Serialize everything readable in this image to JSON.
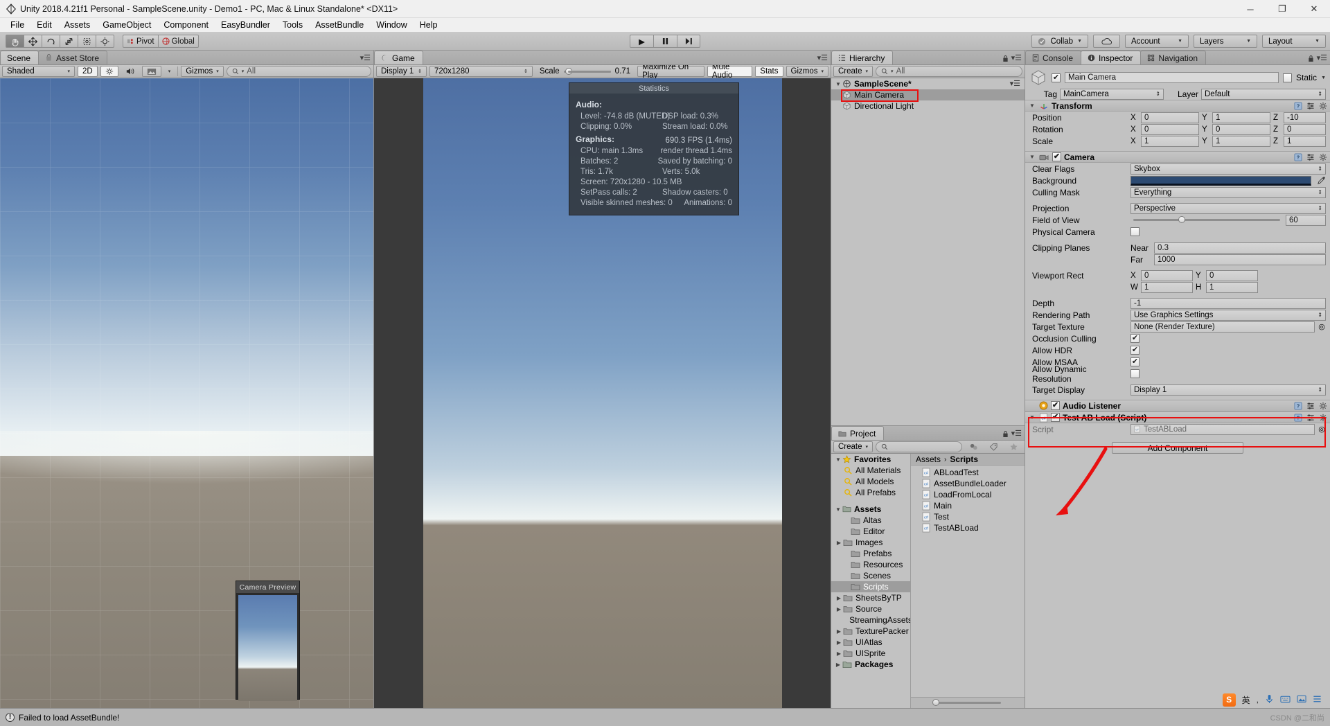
{
  "window": {
    "title": "Unity 2018.4.21f1 Personal - SampleScene.unity - Demo1 - PC, Mac & Linux Standalone* <DX11>",
    "minimize": "─",
    "maximize": "❐",
    "close": "✕"
  },
  "menu": [
    "File",
    "Edit",
    "Assets",
    "GameObject",
    "Component",
    "EasyBundler",
    "Tools",
    "AssetBundle",
    "Window",
    "Help"
  ],
  "toolbar": {
    "transform_tools": [
      "hand-tool",
      "move-tool",
      "rotate-tool",
      "scale-tool",
      "rect-tool",
      "transform-tool"
    ],
    "pivot_label": "Pivot",
    "global_label": "Global",
    "play": "▶",
    "pause": "▐▐",
    "step": "▶|",
    "collab_label": "Collab",
    "cloud_label": "cloud-icon",
    "account_label": "Account",
    "layers_label": "Layers",
    "layout_label": "Layout"
  },
  "scene_panel": {
    "tabs": [
      {
        "label": "Scene",
        "active": true
      },
      {
        "label": "Asset Store",
        "active": false
      }
    ],
    "shading_mode": "Shaded",
    "mode_2d": "2D",
    "gizmos_label": "Gizmos",
    "search_placeholder": "All",
    "camera_preview_title": "Camera Preview"
  },
  "game_panel": {
    "tabs": [
      {
        "label": "Game",
        "active": true
      }
    ],
    "display": "Display 1",
    "resolution": "720x1280",
    "scale_label": "Scale",
    "scale_value": "0.71",
    "maximize_on_play": "Maximize On Play",
    "mute_audio": "Mute Audio",
    "stats": "Stats",
    "gizmos": "Gizmos"
  },
  "statistics": {
    "title": "Statistics",
    "audio_header": "Audio:",
    "audio_rows": [
      {
        "left": "Level: -74.8 dB (MUTED)",
        "right": "DSP load: 0.3%"
      },
      {
        "left": "Clipping: 0.0%",
        "right": "Stream load: 0.0%"
      }
    ],
    "graphics_header": "Graphics:",
    "fps": "690.3 FPS (1.4ms)",
    "graphics_rows": [
      {
        "left": "CPU: main 1.3ms",
        "right": "render thread 1.4ms"
      },
      {
        "left": "Batches: 2",
        "right": "Saved by batching: 0"
      },
      {
        "left": "Tris: 1.7k",
        "right": "Verts: 5.0k"
      },
      {
        "left": "Screen: 720x1280 - 10.5 MB",
        "right": ""
      },
      {
        "left": "SetPass calls: 2",
        "right": "Shadow casters: 0"
      },
      {
        "left": "Visible skinned meshes: 0",
        "right": "Animations: 0"
      }
    ]
  },
  "hierarchy": {
    "tab_label": "Hierarchy",
    "create_label": "Create",
    "search_placeholder": "All",
    "scene_name": "SampleScene*",
    "items": [
      {
        "label": "Main Camera",
        "selected": true,
        "highlighted": true
      },
      {
        "label": "Directional Light",
        "selected": false,
        "highlighted": false
      }
    ]
  },
  "project": {
    "tab_label": "Project",
    "create_label": "Create",
    "search_placeholder": "",
    "favorites_label": "Favorites",
    "favorites": [
      "All Materials",
      "All Models",
      "All Prefabs"
    ],
    "assets_label": "Assets",
    "folders": [
      {
        "label": "Altas",
        "expandable": false,
        "selected": false
      },
      {
        "label": "Editor",
        "expandable": false,
        "selected": false
      },
      {
        "label": "Images",
        "expandable": true,
        "selected": false
      },
      {
        "label": "Prefabs",
        "expandable": false,
        "selected": false
      },
      {
        "label": "Resources",
        "expandable": false,
        "selected": false
      },
      {
        "label": "Scenes",
        "expandable": false,
        "selected": false
      },
      {
        "label": "Scripts",
        "expandable": false,
        "selected": true
      },
      {
        "label": "SheetsByTP",
        "expandable": true,
        "selected": false
      },
      {
        "label": "Source",
        "expandable": true,
        "selected": false
      },
      {
        "label": "StreamingAssets",
        "expandable": false,
        "selected": false
      },
      {
        "label": "TexturePacker",
        "expandable": true,
        "selected": false
      },
      {
        "label": "UIAtlas",
        "expandable": true,
        "selected": false
      },
      {
        "label": "UISprite",
        "expandable": true,
        "selected": false
      }
    ],
    "packages_label": "Packages",
    "breadcrumb": [
      "Assets",
      "Scripts"
    ],
    "files": [
      "ABLoadTest",
      "AssetBundleLoader",
      "LoadFromLocal",
      "Main",
      "Test",
      "TestABLoad"
    ]
  },
  "inspector": {
    "tabs": [
      {
        "label": "Console",
        "active": false
      },
      {
        "label": "Inspector",
        "active": true
      },
      {
        "label": "Navigation",
        "active": false
      }
    ],
    "object_name": "Main Camera",
    "object_enabled": true,
    "static_label": "Static",
    "static_checked": false,
    "tag_label": "Tag",
    "tag_value": "MainCamera",
    "layer_label": "Layer",
    "layer_value": "Default",
    "transform": {
      "title": "Transform",
      "position_label": "Position",
      "position": {
        "x": "0",
        "y": "1",
        "z": "-10"
      },
      "rotation_label": "Rotation",
      "rotation": {
        "x": "0",
        "y": "0",
        "z": "0"
      },
      "scale_label": "Scale",
      "scale": {
        "x": "1",
        "y": "1",
        "z": "1"
      }
    },
    "camera": {
      "title": "Camera",
      "enabled": true,
      "clear_flags_label": "Clear Flags",
      "clear_flags_value": "Skybox",
      "background_label": "Background",
      "background_color": "#2c4a72",
      "culling_mask_label": "Culling Mask",
      "culling_mask_value": "Everything",
      "projection_label": "Projection",
      "projection_value": "Perspective",
      "fov_label": "Field of View",
      "fov_value": "60",
      "physical_camera_label": "Physical Camera",
      "physical_camera_checked": false,
      "clipping_label": "Clipping Planes",
      "near_label": "Near",
      "near_value": "0.3",
      "far_label": "Far",
      "far_value": "1000",
      "viewport_label": "Viewport Rect",
      "viewport": {
        "x": "0",
        "y": "0",
        "w": "1",
        "h": "1"
      },
      "depth_label": "Depth",
      "depth_value": "-1",
      "rendering_path_label": "Rendering Path",
      "rendering_path_value": "Use Graphics Settings",
      "target_texture_label": "Target Texture",
      "target_texture_value": "None (Render Texture)",
      "occlusion_label": "Occlusion Culling",
      "occlusion_checked": true,
      "hdr_label": "Allow HDR",
      "hdr_checked": true,
      "msaa_label": "Allow MSAA",
      "msaa_checked": true,
      "dynres_label": "Allow Dynamic Resolution",
      "dynres_checked": false,
      "target_display_label": "Target Display",
      "target_display_value": "Display 1"
    },
    "audio_listener": {
      "title": "Audio Listener",
      "enabled": true
    },
    "script_component": {
      "title": "Test AB Load (Script)",
      "enabled": true,
      "script_label": "Script",
      "script_value": "TestABLoad"
    },
    "add_component_label": "Add Component"
  },
  "statusbar": {
    "message": "Failed to load AssetBundle!",
    "icon": "error-icon"
  },
  "ime": {
    "logo": "S",
    "lang": "英",
    "items": [
      "mic-icon",
      "keyboard-icon",
      "image-icon",
      "menu-icon"
    ]
  },
  "watermark": "CSDN @二和尚"
}
